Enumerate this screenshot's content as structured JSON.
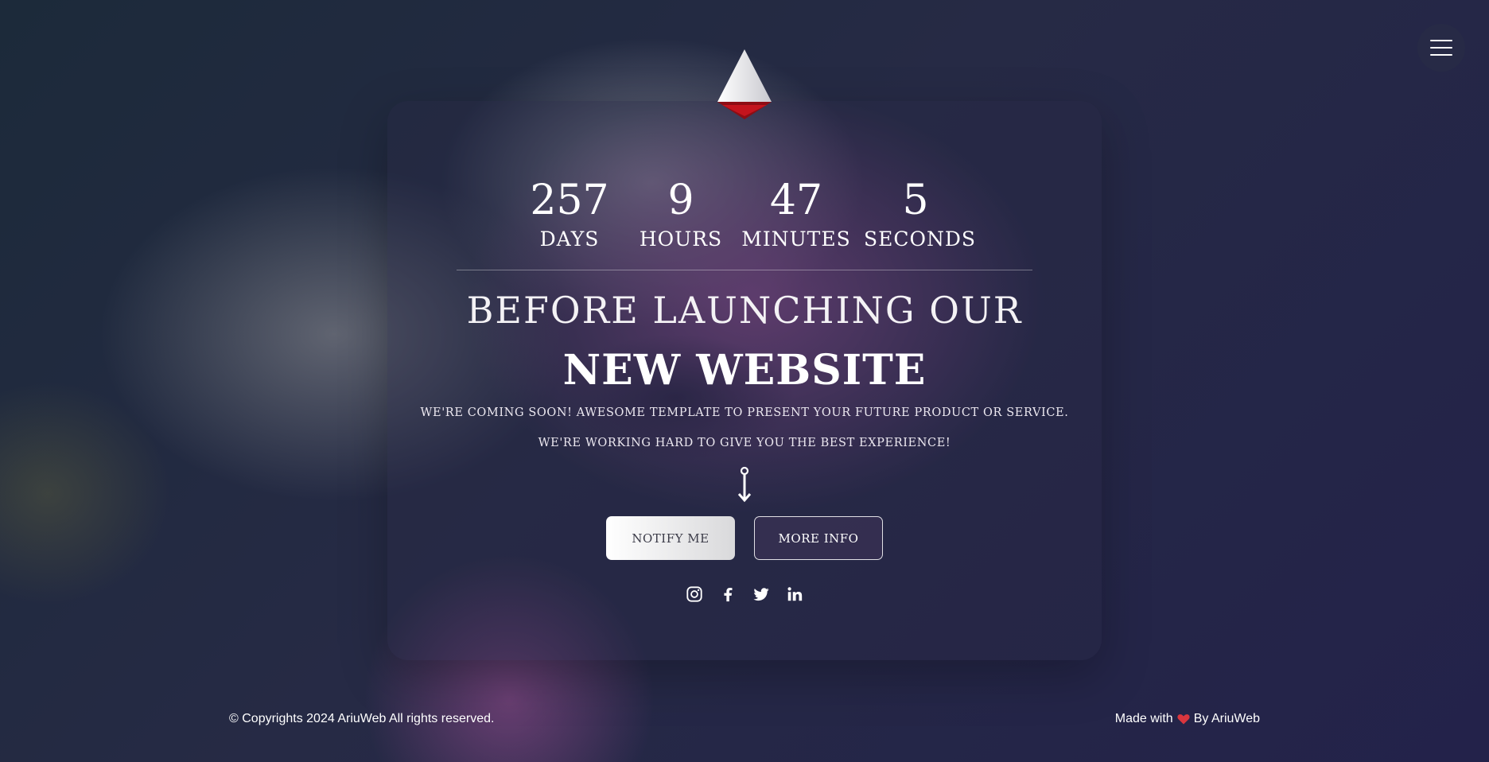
{
  "countdown": [
    {
      "value": "257",
      "label": "DAYS"
    },
    {
      "value": "9",
      "label": "HOURS"
    },
    {
      "value": "47",
      "label": "MINUTES"
    },
    {
      "value": "5",
      "label": "SECONDS"
    }
  ],
  "hero": {
    "headline_line1": "BEFORE LAUNCHING OUR",
    "headline_line2": "NEW WEBSITE",
    "subtext_line1": "WE'RE COMING SOON! AWESOME TEMPLATE TO PRESENT YOUR FUTURE PRODUCT OR SERVICE.",
    "subtext_line2": "WE'RE WORKING HARD TO GIVE YOU THE BEST EXPERIENCE!"
  },
  "buttons": {
    "notify_label": "NOTIFY ME",
    "more_info_label": "MORE INFO"
  },
  "socials": [
    {
      "icon": "instagram-icon"
    },
    {
      "icon": "facebook-icon"
    },
    {
      "icon": "twitter-icon"
    },
    {
      "icon": "linkedin-icon"
    }
  ],
  "footer": {
    "copyright": "© Copyrights 2024 AriuWeb All rights reserved.",
    "made_with": "Made with",
    "by": "By AriuWeb"
  },
  "colors": {
    "heart": "#d9363e",
    "logo_accent": "#b3121a"
  },
  "icons": {
    "menu": "hamburger-menu-icon",
    "logo": "triangle-logo-icon",
    "scroll": "scroll-down-arrow-icon",
    "heart": "heart-icon"
  }
}
